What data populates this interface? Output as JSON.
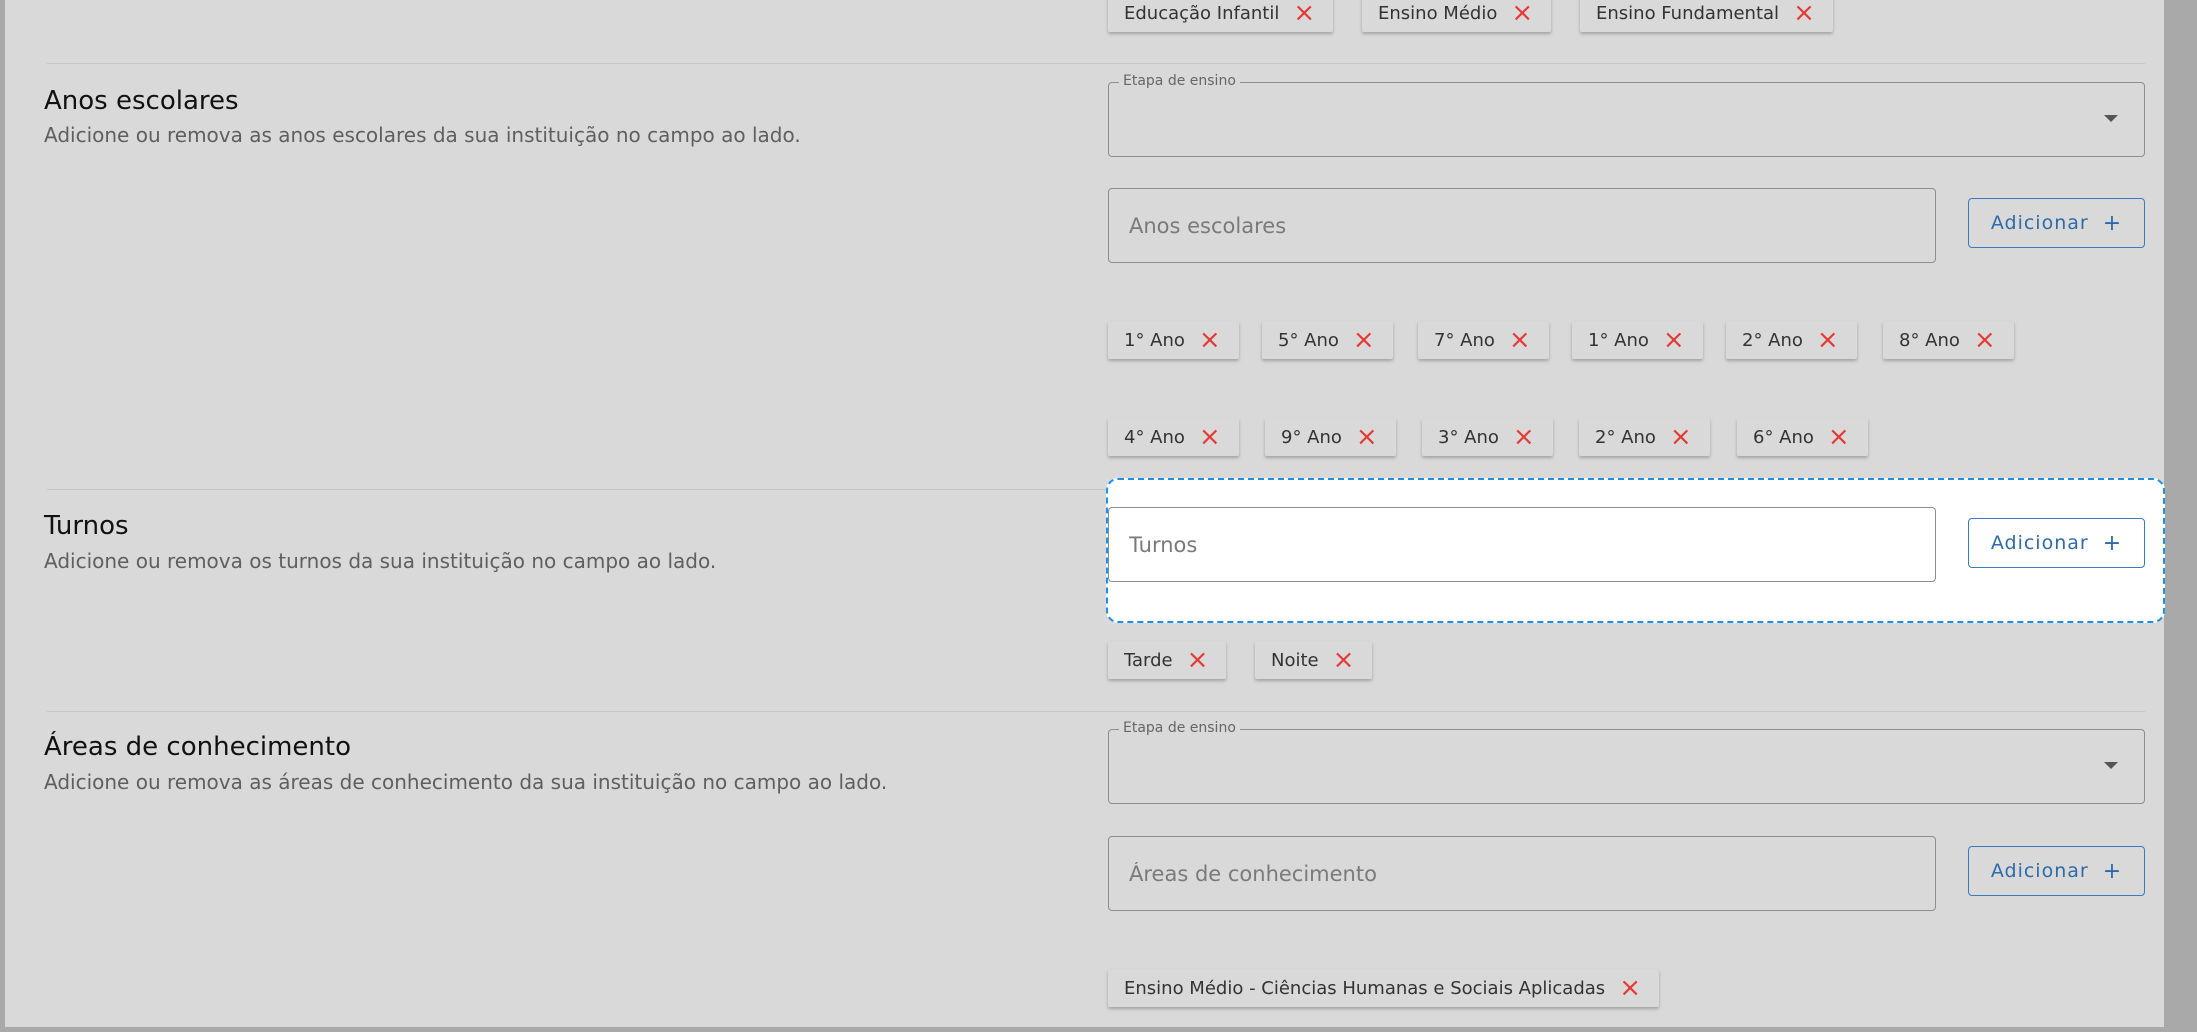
{
  "etapas_tags": [
    {
      "label": "Educação Infantil"
    },
    {
      "label": "Ensino Médio"
    },
    {
      "label": "Ensino Fundamental"
    }
  ],
  "anos": {
    "title": "Anos escolares",
    "description": "Adicione ou remova as anos escolares da sua instituição no campo ao lado.",
    "select_legend": "Etapa de ensino",
    "input_placeholder": "Anos escolares",
    "add_label": "Adicionar",
    "tags_row1": [
      {
        "label": "1° Ano"
      },
      {
        "label": "5° Ano"
      },
      {
        "label": "7° Ano"
      },
      {
        "label": "1° Ano"
      },
      {
        "label": "2° Ano"
      },
      {
        "label": "8° Ano"
      }
    ],
    "tags_row2": [
      {
        "label": "4° Ano"
      },
      {
        "label": "9° Ano"
      },
      {
        "label": "3° Ano"
      },
      {
        "label": "2° Ano"
      },
      {
        "label": "6° Ano"
      }
    ]
  },
  "turnos": {
    "title": "Turnos",
    "description": "Adicione ou remova os turnos da sua instituição no campo ao lado.",
    "input_placeholder": "Turnos",
    "add_label": "Adicionar",
    "tags": [
      {
        "label": "Tarde"
      },
      {
        "label": "Noite"
      }
    ]
  },
  "areas": {
    "title": "Áreas de conhecimento",
    "description": "Adicione ou remova as áreas de conhecimento da sua instituição no campo ao lado.",
    "select_legend": "Etapa de ensino",
    "input_placeholder": "Áreas de conhecimento",
    "add_label": "Adicionar",
    "tags": [
      {
        "label": "Ensino Médio - Ciências Humanas e Sociais Aplicadas"
      }
    ]
  },
  "icons": {
    "remove": "close-icon",
    "add": "plus-icon",
    "dropdown": "caret-down-icon"
  },
  "colors": {
    "remove_icon": "#e53935",
    "button_accent": "#2f6aa8",
    "focus_outline": "#1e8fe6"
  }
}
